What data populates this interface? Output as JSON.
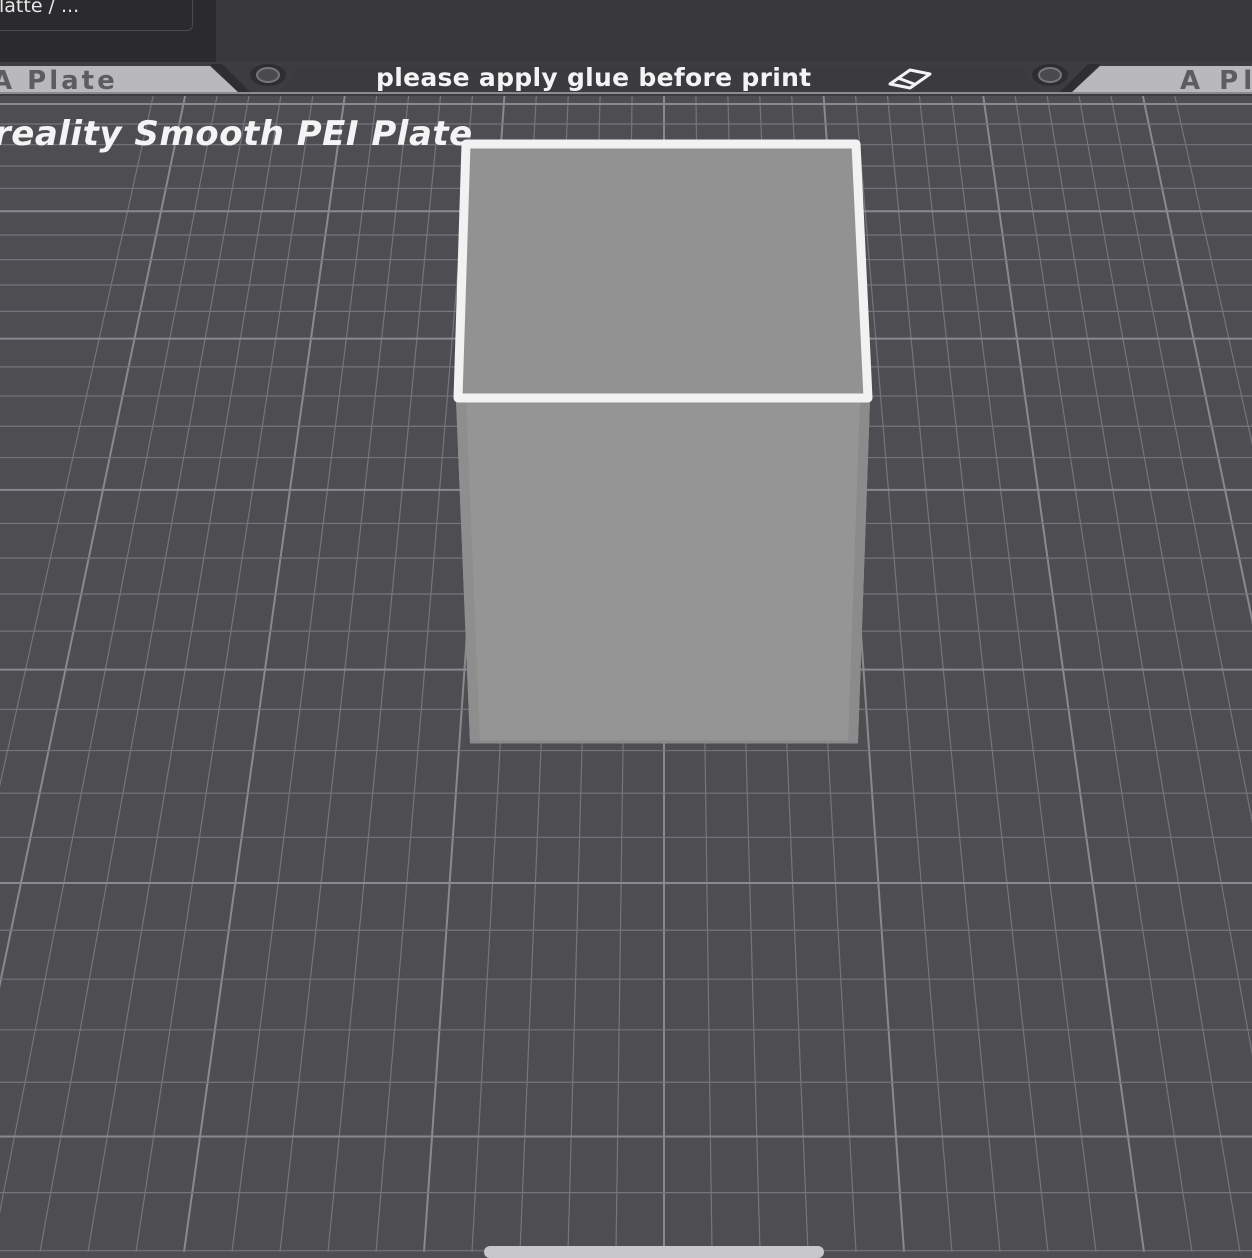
{
  "preset": {
    "text": "latte / ..."
  },
  "bed": {
    "glue_notice": "please apply glue before print",
    "plate_label_left": "A Plate",
    "plate_label_right": "A Pl",
    "plate_name": "reality Smooth PEI Plate"
  },
  "colors": {
    "background": "#4e4d52",
    "grid_line": "#76757b",
    "grid_line_major": "#8a898f",
    "model_fill": "#959595",
    "model_top": "#8f8f8f",
    "model_edge_highlight": "#f2f2f2"
  },
  "icons": {
    "eraser": "eraser-icon",
    "screw_left": "screw-icon",
    "screw_right": "screw-icon"
  }
}
